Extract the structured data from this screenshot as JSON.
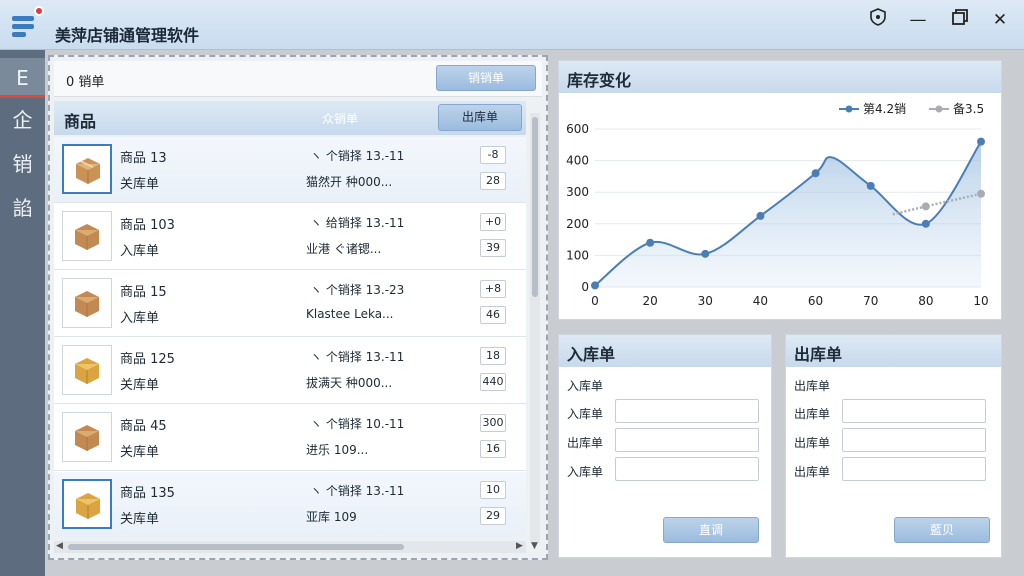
{
  "app": {
    "title": "美萍店铺通管理软件"
  },
  "sidebar": {
    "items": [
      {
        "label": "E",
        "active": true
      },
      {
        "label": "企"
      },
      {
        "label": "销"
      },
      {
        "label": "諂"
      }
    ]
  },
  "left": {
    "top_tab_label": "0 销单",
    "top_button": "销销单",
    "header_title": "商品",
    "header_mid": "众销单",
    "header_button": "出库单",
    "rows": [
      {
        "name": "商品 13",
        "type": "关库单",
        "d1": "ヽ 个销择 13.-11",
        "d2": "猫然开 种000...",
        "q1": "-8",
        "q2": "28",
        "selected": true
      },
      {
        "name": "商品 103",
        "type": "入库单",
        "d1": "ヽ 给销择 13.-11",
        "d2": "业港 ぐ诸锶...",
        "q1": "+0",
        "q2": "39"
      },
      {
        "name": "商品 15",
        "type": "入库单",
        "d1": "ヽ 个销择 13.-23",
        "d2": "Klastee Leka...",
        "q1": "+8",
        "q2": "46"
      },
      {
        "name": "商品 125",
        "type": "关库单",
        "d1": "ヽ 个销择 13.-11",
        "d2": "拔满天 种000...",
        "q1": "18",
        "q2": "440"
      },
      {
        "name": "商品 45",
        "type": "关库单",
        "d1": "ヽ 个销择 10.-11",
        "d2": "进乐 109...",
        "q1": "300",
        "q2": "16"
      },
      {
        "name": "商品 135",
        "type": "关库单",
        "d1": "ヽ 个销择 13.-11",
        "d2": "亚库 109",
        "q1": "10",
        "q2": "29",
        "selected": true
      }
    ]
  },
  "chart_panel": {
    "title": "库存变化"
  },
  "chart_data": {
    "type": "line",
    "x_ticks": [
      "0",
      "20",
      "30",
      "40",
      "60",
      "70",
      "80",
      "10"
    ],
    "y_ticks": [
      0,
      100,
      200,
      300,
      400,
      600
    ],
    "ylim": [
      0,
      500
    ],
    "legend_position": "top-right",
    "series": [
      {
        "name": "第4.2销",
        "color": "#4a7eb5",
        "points": [
          [
            0,
            5
          ],
          [
            1,
            140
          ],
          [
            2,
            105
          ],
          [
            3,
            225
          ],
          [
            4,
            360
          ],
          [
            5,
            320
          ],
          [
            6,
            200
          ],
          [
            7,
            460
          ]
        ],
        "peak": [
          4.3,
          410
        ]
      },
      {
        "name": "备3.5",
        "color": "#a9adb1",
        "points": [
          [
            5.4,
            230
          ],
          [
            6,
            255
          ],
          [
            7,
            295
          ]
        ]
      }
    ]
  },
  "in_panel": {
    "title": "入库单",
    "subtitle": "入库单",
    "labels": [
      "入库单",
      "出库单",
      "入库单"
    ],
    "button": "直调"
  },
  "out_panel": {
    "title": "出库单",
    "subtitle": "出库单",
    "labels": [
      "出库单",
      "出库单",
      "出库单"
    ],
    "button": "藍贝"
  }
}
